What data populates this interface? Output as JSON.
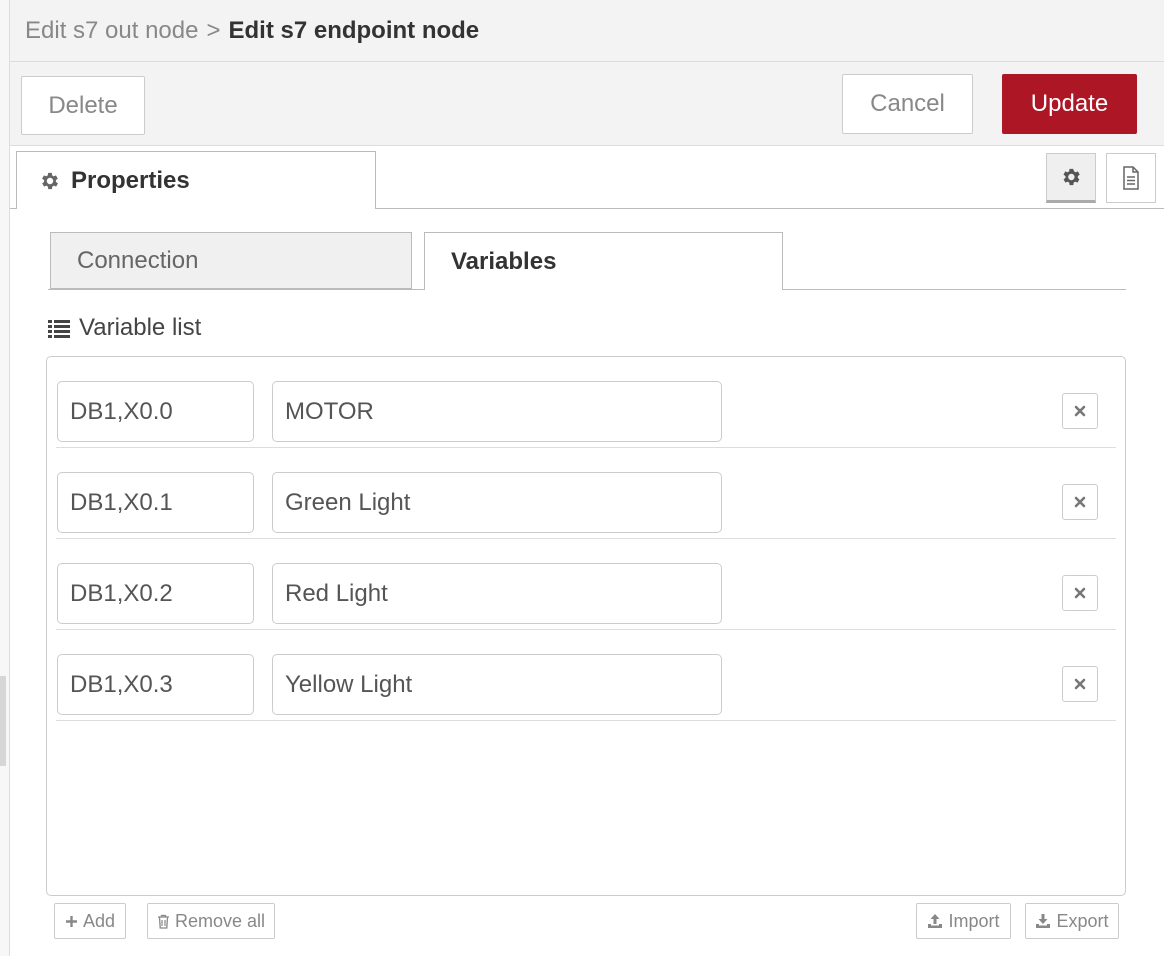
{
  "header": {
    "breadcrumb_parent": "Edit s7 out node",
    "breadcrumb_separator": ">",
    "breadcrumb_current": "Edit s7 endpoint node"
  },
  "toolbar": {
    "delete_label": "Delete",
    "cancel_label": "Cancel",
    "update_label": "Update"
  },
  "tabs": {
    "properties_label": "Properties"
  },
  "subtabs": {
    "connection_label": "Connection",
    "variables_label": "Variables"
  },
  "variable_list": {
    "label": "Variable list",
    "rows": [
      {
        "address": "DB1,X0.0",
        "name": "MOTOR"
      },
      {
        "address": "DB1,X0.1",
        "name": "Green Light"
      },
      {
        "address": "DB1,X0.2",
        "name": "Red Light"
      },
      {
        "address": "DB1,X0.3",
        "name": "Yellow Light"
      }
    ]
  },
  "list_actions": {
    "add_label": "Add",
    "remove_all_label": "Remove all",
    "import_label": "Import",
    "export_label": "Export"
  },
  "colors": {
    "update_button_bg": "#ad1625",
    "header_bg": "#f3f3f3"
  },
  "icons": {
    "properties": "gear-icon",
    "settings_side": "gear-icon",
    "info_side": "document-icon",
    "list": "list-icon",
    "row_remove": "close-icon",
    "add": "plus-icon",
    "remove_all": "trash-icon",
    "import": "upload-icon",
    "export": "download-icon"
  }
}
